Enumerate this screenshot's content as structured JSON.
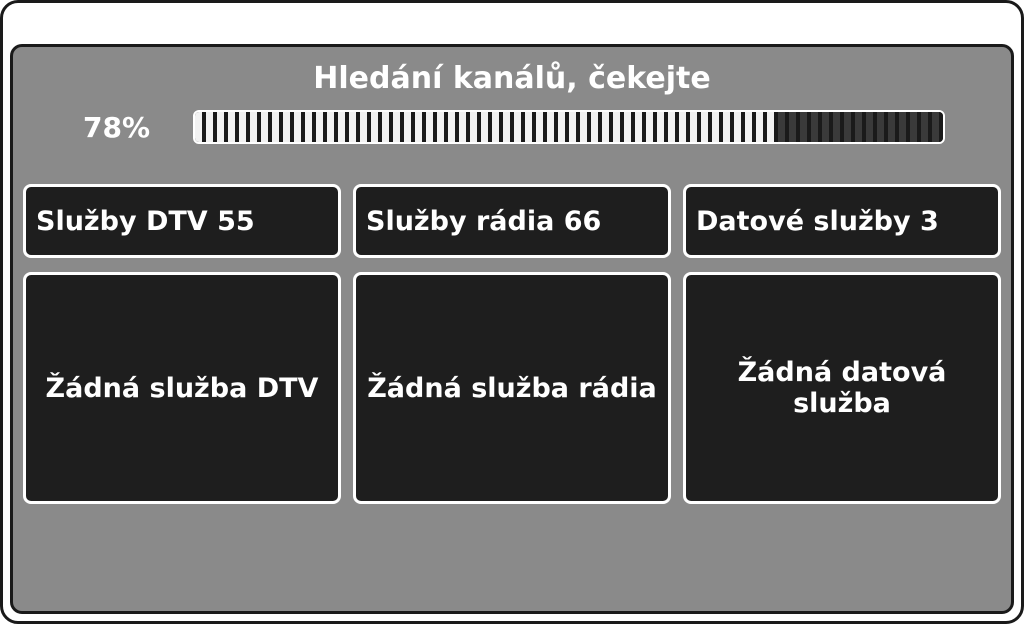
{
  "title": "Hledání kanálů, čekejte",
  "progress": {
    "percent_label": "78%",
    "percent_value": 78
  },
  "columns": [
    {
      "header": "Služby DTV 55",
      "content": "Žádná služba DTV"
    },
    {
      "header": "Služby rádia 66",
      "content": "Žádná služba rádia"
    },
    {
      "header": "Datové služby 3",
      "content": "Žádná datová služba"
    }
  ]
}
